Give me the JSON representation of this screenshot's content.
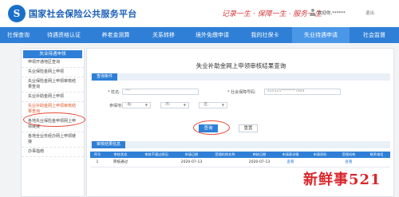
{
  "header": {
    "logo_glyph": "S",
    "title": "国家社会保险公共服务平台",
    "slogan": "记录一生 · 保障一生 · 服务一生",
    "welcome": "欢迎你,******",
    "logout": "退出"
  },
  "nav": {
    "items": [
      "社保查询",
      "待遇资格认证",
      "养老金测算",
      "关系转移",
      "境外免缴申请",
      "我的社保卡",
      "失业待遇申请",
      "社会监督"
    ],
    "active_index": 6
  },
  "sidebar": {
    "heading": "失业待遇申领",
    "items": [
      "申领开通地区查询",
      "失业保险金网上申领",
      "失业保险金网上申领审核结果查询",
      "失业补助金网上申领",
      "失业补助金网上申领审核结果查询",
      "各地失业保险金申领网上申领链接",
      "各地全业务经办网上申领链接",
      "办事指南"
    ],
    "active_index": 4
  },
  "main": {
    "title": "失业补助金网上申领审核结果查询",
    "query_section": "查询条件",
    "name_label": "姓名",
    "name_value": "***",
    "id_label": "社会保障号码",
    "id_value": "410325********7844",
    "region_label": "参保地",
    "select_1": "-省-",
    "select_2": "-市-",
    "select_3": "-区-",
    "query_button": "查询",
    "reset_button": "重置",
    "result_section": "审核结果信息",
    "table": {
      "headers": [
        "序号",
        "审核状态",
        "审核不通过原因",
        "申请日期",
        "受理机构名称",
        "审核日期",
        "申请表详情",
        "申请资料",
        "受理机构",
        "联系电话"
      ],
      "rows": [
        [
          "1",
          "审核通过",
          "",
          "2020-07-13",
          "",
          "2020-07-13",
          "查看",
          "",
          "查看",
          ""
        ]
      ]
    }
  },
  "watermark": "新鲜事521"
}
